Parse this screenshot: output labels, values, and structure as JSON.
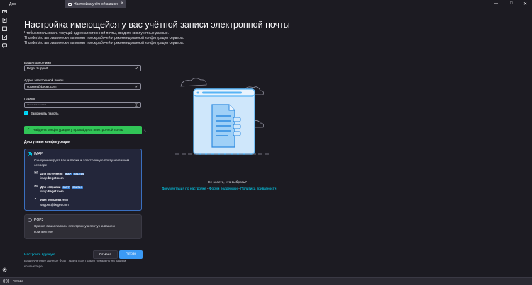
{
  "window": {
    "app_label": "Дом",
    "tab_label": "Настройка учётной записи",
    "tab_close": "×",
    "minimize": "—",
    "maximize": "□",
    "close": "✕"
  },
  "page": {
    "heading": "Настройка имеющейся у вас учётной записи электронной почты",
    "intro_lines": [
      "Чтобы использовать текущий адрес электронной почты, введите свои учетные данные.",
      "Thunderbird автоматически выполнит поиск рабочей и рекомендованной конфигурации сервера.",
      "Thunderbird автоматически выполнит поиск рабочей и рекомендованной конфигурации сервера."
    ]
  },
  "form": {
    "name_label": "Ваше полное имя",
    "name_value": "Beget Support",
    "email_label": "Адрес электронной почты",
    "email_value": "support@beget.com",
    "password_label": "Пароль",
    "password_value": "•••••••••••••••••",
    "remember_label": "Запомнить пароль"
  },
  "status": {
    "found_message": "Найдена конфигурация у провайдера электронной почты"
  },
  "configs": {
    "title": "Доступные конфигурации",
    "imap": {
      "name": "IMAP",
      "desc_line1": "Синхронизирует ваши папки и электронную почту на вашем",
      "desc_line2": "сервере",
      "incoming_label": "Для получения",
      "incoming_badge1": "IMAP",
      "incoming_badge2": "SSL/TLS",
      "incoming_host_prefix": "imap.",
      "incoming_host_bold": "beget.com",
      "outgoing_label": "Для отправки",
      "outgoing_badge1": "SMTP",
      "outgoing_badge2": "SSL/TLS",
      "outgoing_host_prefix": "smtp.",
      "outgoing_host_bold": "beget.com",
      "username_label": "Имя пользователя",
      "username_value": "support@beget.com"
    },
    "pop3": {
      "name": "POP3",
      "desc_line1": "Хранит ваши папки и электронную почту на вашем",
      "desc_line2": "компьютере"
    }
  },
  "actions": {
    "manual_link": "Настроить вручную",
    "cancel": "Отмена",
    "done": "Готово"
  },
  "footnote": {
    "line1": "Ваши учётные данные будут храниться только локально на вашем",
    "line2": "компьютере."
  },
  "help": {
    "question": "Не знаете, что выбрать?",
    "link_docs": "Документация по настройке",
    "sep1": " - ",
    "link_forum": "Форум поддержки",
    "sep2": " - ",
    "link_privacy": "Политика приватности"
  },
  "statusbar": {
    "text": "Готово"
  },
  "icons": {
    "check": "✓",
    "password_reveal": "◫",
    "mail_in": "✉",
    "mail_out": "✉",
    "user": "◔",
    "radio_signal": "((•))"
  },
  "colors": {
    "accent": "#00ddff",
    "success": "#31c557",
    "primary_button": "#3b9af5",
    "selected_card_border": "#3a6fbf"
  }
}
